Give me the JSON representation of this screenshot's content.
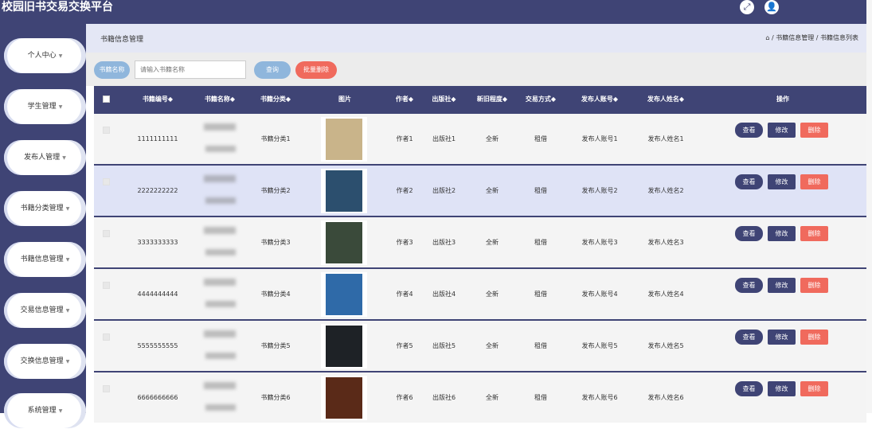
{
  "app": {
    "title": "校园旧书交易交换平台"
  },
  "header_icons": [
    {
      "name": "fullscreen-icon",
      "glyph": "⤢"
    },
    {
      "name": "user-icon",
      "glyph": "👤"
    }
  ],
  "sidebar": {
    "items": [
      {
        "label": "个人中心"
      },
      {
        "label": "学生管理"
      },
      {
        "label": "发布人管理"
      },
      {
        "label": "书籍分类管理"
      },
      {
        "label": "书籍信息管理"
      },
      {
        "label": "交易信息管理"
      },
      {
        "label": "交换信息管理"
      },
      {
        "label": "系统管理"
      }
    ]
  },
  "page": {
    "title": "书籍信息管理",
    "breadcrumb": "⌂ / 书籍信息管理 / 书籍信息列表"
  },
  "search": {
    "label": "书籍名称",
    "placeholder": "请输入书籍名称",
    "search_button": "查询",
    "batch_delete_button": "批量删除"
  },
  "table": {
    "columns": [
      "书籍编号◆",
      "书籍名称◆",
      "书籍分类◆",
      "图片",
      "作者◆",
      "出版社◆",
      "新旧程度◆",
      "交易方式◆",
      "发布人账号◆",
      "发布人姓名◆",
      "操作"
    ],
    "actions": {
      "view": "查看",
      "edit": "修改",
      "delete": "删除"
    },
    "rows": [
      {
        "id": "1111111111",
        "category": "书籍分类1",
        "author": "作者1",
        "publisher": "出版社1",
        "condition": "全新",
        "trade": "租借",
        "account": "发布人账号1",
        "name": "发布人姓名1",
        "cover_color": "#c9b48a"
      },
      {
        "id": "2222222222",
        "category": "书籍分类2",
        "author": "作者2",
        "publisher": "出版社2",
        "condition": "全新",
        "trade": "租借",
        "account": "发布人账号2",
        "name": "发布人姓名2",
        "cover_color": "#2c4f6e"
      },
      {
        "id": "3333333333",
        "category": "书籍分类3",
        "author": "作者3",
        "publisher": "出版社3",
        "condition": "全新",
        "trade": "租借",
        "account": "发布人账号3",
        "name": "发布人姓名3",
        "cover_color": "#3a4a3a"
      },
      {
        "id": "4444444444",
        "category": "书籍分类4",
        "author": "作者4",
        "publisher": "出版社4",
        "condition": "全新",
        "trade": "租借",
        "account": "发布人账号4",
        "name": "发布人姓名4",
        "cover_color": "#2f6aa8"
      },
      {
        "id": "5555555555",
        "category": "书籍分类5",
        "author": "作者5",
        "publisher": "出版社5",
        "condition": "全新",
        "trade": "租借",
        "account": "发布人账号5",
        "name": "发布人姓名5",
        "cover_color": "#1e2226"
      },
      {
        "id": "6666666666",
        "category": "书籍分类6",
        "author": "作者6",
        "publisher": "出版社6",
        "condition": "全新",
        "trade": "租借",
        "account": "发布人账号6",
        "name": "发布人姓名6",
        "cover_color": "#5a2a18"
      }
    ]
  },
  "colors": {
    "primary": "#3f4475",
    "accent_blue": "#8fb6dc",
    "danger": "#f06a5d",
    "highlight_row": "#dfe3f6"
  }
}
